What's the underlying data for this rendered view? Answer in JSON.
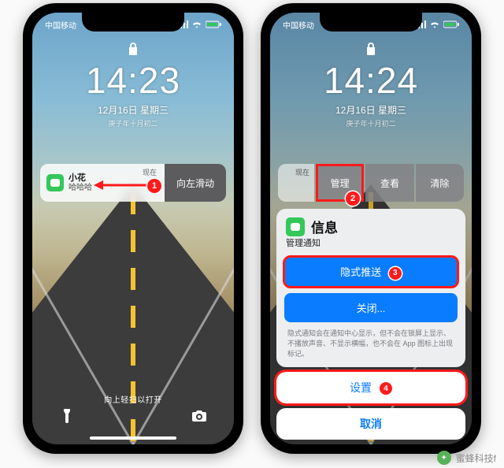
{
  "statusbar": {
    "carrier": "中国移动"
  },
  "phone1": {
    "clock": "14:23",
    "date": "12月16日 星期三",
    "dateSub": "庚子年十月初二",
    "notification": {
      "time": "现在",
      "title": "小花",
      "body": "哈哈哈",
      "swipe": "向左滑动"
    },
    "hint": "向上轻扫以打开"
  },
  "phone2": {
    "clock": "14:24",
    "date": "12月16日 星期三",
    "dateSub": "庚子年十月初二",
    "notifTime": "现在",
    "actions": {
      "manage": "管理",
      "view": "查看",
      "clear": "清除"
    },
    "sheet": {
      "appName": "信息",
      "subtitle": "管理通知",
      "btnQuiet": "隐式推送",
      "btnOff": "关闭...",
      "note": "隐式通知会在通知中心显示，但不会在锁屏上显示、不播放声音、不显示横幅，也不会在 App 图标上出现标记。",
      "settings": "设置",
      "cancel": "取消"
    }
  },
  "annotations": {
    "badge1": "1",
    "badge2": "2",
    "badge3": "3",
    "badge4": "4"
  },
  "watermark": {
    "text": "蜜蜂科技f"
  }
}
